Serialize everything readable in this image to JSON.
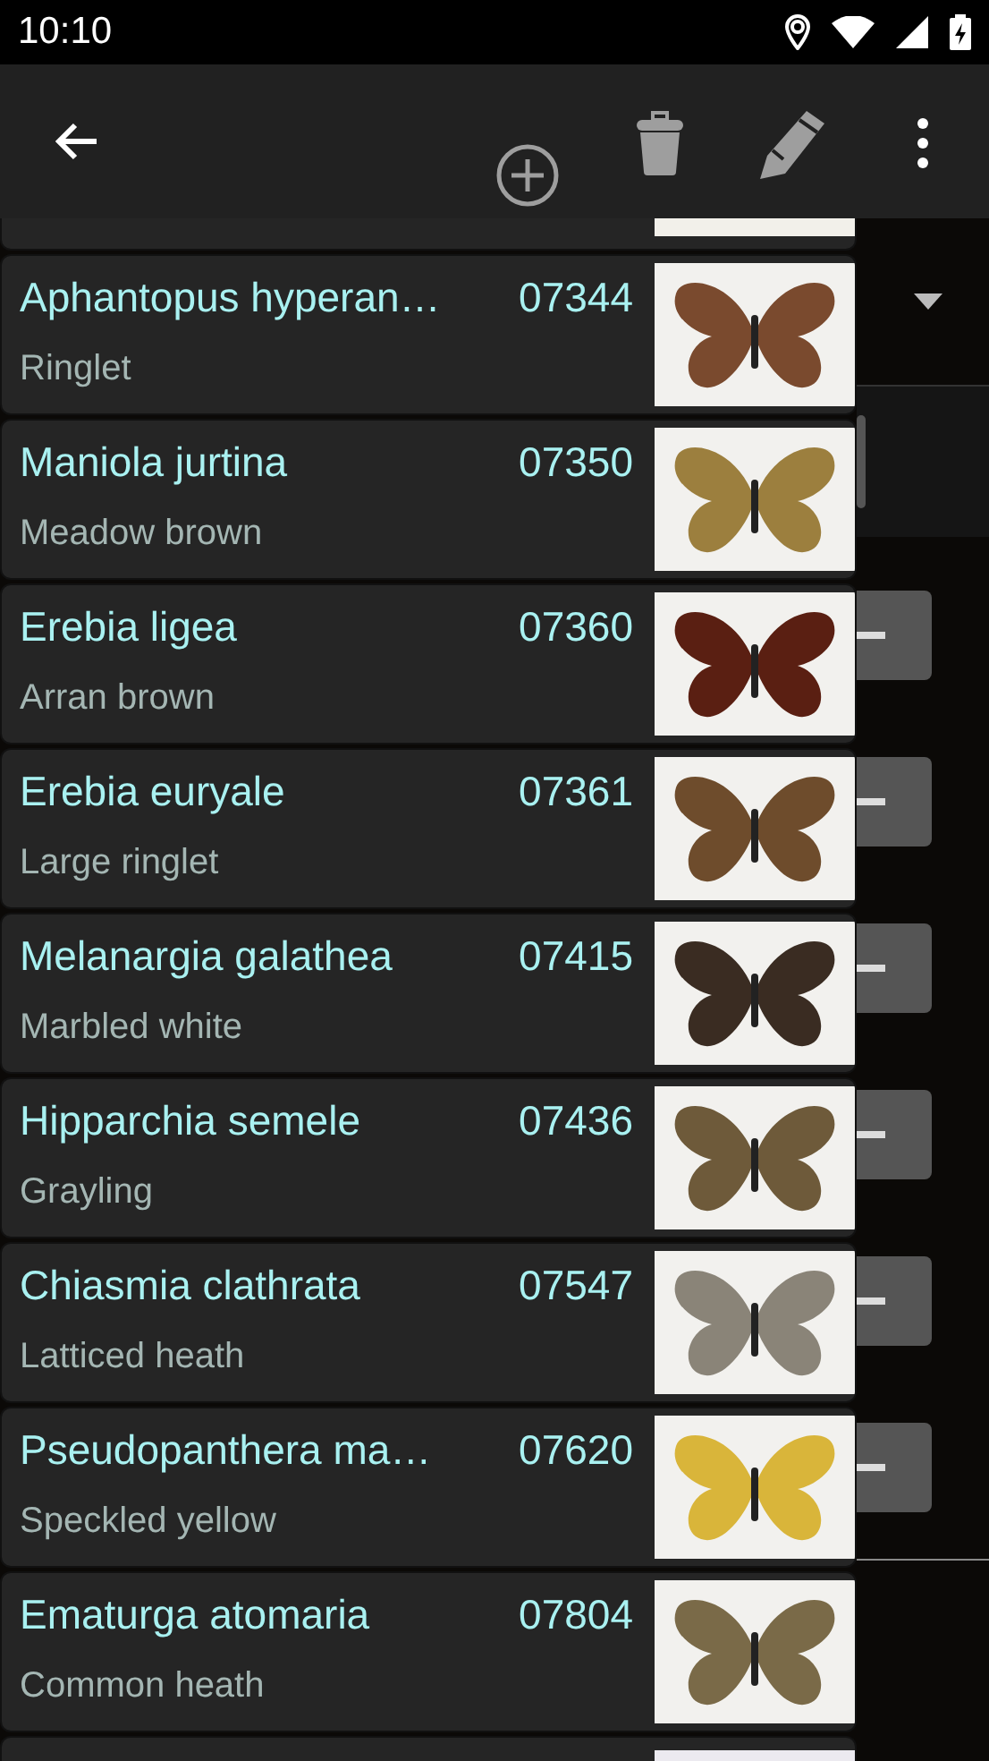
{
  "status_bar": {
    "time": "10:10"
  },
  "species": [
    {
      "name": "Aphantopus hyperan…",
      "code": "07344",
      "common": "Ringlet"
    },
    {
      "name": "Maniola jurtina",
      "code": "07350",
      "common": "Meadow brown"
    },
    {
      "name": "Erebia ligea",
      "code": "07360",
      "common": "Arran brown"
    },
    {
      "name": "Erebia euryale",
      "code": "07361",
      "common": "Large ringlet"
    },
    {
      "name": "Melanargia galathea",
      "code": "07415",
      "common": "Marbled white"
    },
    {
      "name": "Hipparchia semele",
      "code": "07436",
      "common": "Grayling"
    },
    {
      "name": "Chiasmia clathrata",
      "code": "07547",
      "common": "Latticed heath"
    },
    {
      "name": "Pseudopanthera ma…",
      "code": "07620",
      "common": "Speckled yellow"
    },
    {
      "name": "Ematurga atomaria",
      "code": "07804",
      "common": "Common heath"
    }
  ]
}
